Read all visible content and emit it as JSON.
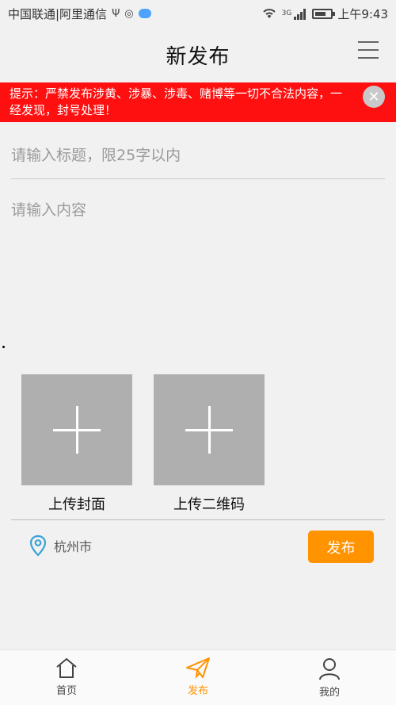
{
  "status_bar": {
    "carrier": "中国联通|阿里通信",
    "time": "上午9:43",
    "network": "3G",
    "battery_fraction": 0.7,
    "icons": [
      "usb-icon",
      "globe-icon",
      "chat-bubble-icon",
      "wifi-icon",
      "signal-icon",
      "battery-icon"
    ]
  },
  "header": {
    "title": "新发布",
    "menu_icon": "hamburger-menu-icon"
  },
  "banner": {
    "text": "提示：严禁发布涉黄、涉暴、涉毒、赌博等一切不合法内容，一经发现，封号处理！",
    "close_icon": "close-icon",
    "bg_color": "#ff1010"
  },
  "form": {
    "title_placeholder": "请输入标题，限25字以内",
    "title_value": "",
    "content_placeholder": "请输入内容",
    "content_value": ""
  },
  "uploads": {
    "cover_label": "上传封面",
    "qr_label": "上传二维码"
  },
  "location": {
    "icon": "location-pin-icon",
    "city": "杭州市"
  },
  "actions": {
    "publish_label": "发布",
    "accent_color": "#ff9300"
  },
  "bottom_nav": {
    "items": [
      {
        "label": "首页",
        "icon": "home-icon"
      },
      {
        "label": "发布",
        "icon": "paper-plane-icon",
        "active": true
      },
      {
        "label": "我的",
        "icon": "user-icon"
      }
    ]
  }
}
